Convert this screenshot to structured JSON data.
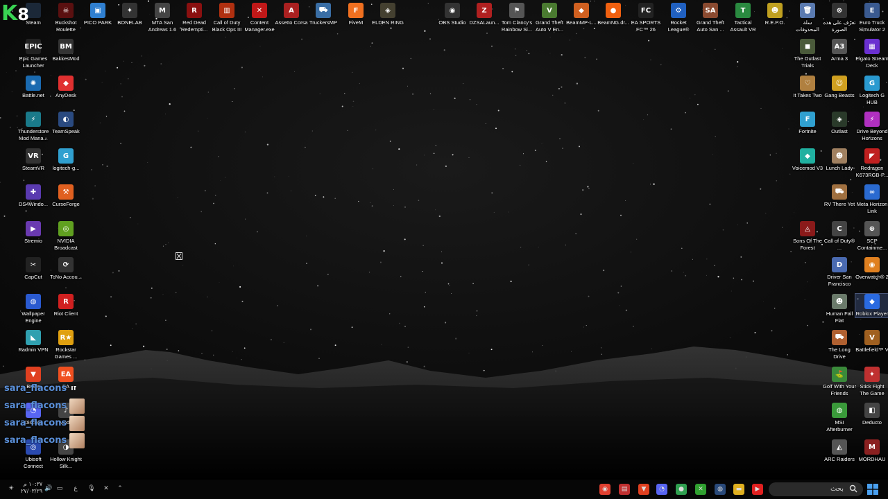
{
  "overlay": {
    "k": "K",
    "eight": "8"
  },
  "desktop_icons": [
    {
      "id": "steam",
      "label": "Steam",
      "glyph": "",
      "color": "#1b2838"
    },
    {
      "id": "buckshot",
      "label": "Buckshot Roulette",
      "glyph": "☠",
      "color": "#5a1010"
    },
    {
      "id": "pico",
      "label": "PICO PARK",
      "glyph": "▣",
      "color": "#2f7fd0"
    },
    {
      "id": "bonelab",
      "label": "BONELAB",
      "glyph": "✦",
      "color": "#333333"
    },
    {
      "id": "mta",
      "label": "MTA San Andreas 1.6",
      "glyph": "M",
      "color": "#444444"
    },
    {
      "id": "rdr",
      "label": "Red Dead Redempti...",
      "glyph": "R",
      "color": "#8a1010"
    },
    {
      "id": "cod",
      "label": "Call of Duty Black Ops III",
      "glyph": "▥",
      "color": "#b03010"
    },
    {
      "id": "cm",
      "label": "Content Manager.exe",
      "glyph": "✕",
      "color": "#c01818"
    },
    {
      "id": "assetto",
      "label": "Assetto Corsa",
      "glyph": "A",
      "color": "#aa2020"
    },
    {
      "id": "truckersmp",
      "label": "TruckersMP",
      "glyph": "⛟",
      "color": "#3a6ea5"
    },
    {
      "id": "fivem",
      "label": "FiveM",
      "glyph": "F",
      "color": "#f07020"
    },
    {
      "id": "eldenring",
      "label": "ELDEN RING",
      "glyph": "◈",
      "color": "#444030"
    },
    {
      "id": "obs",
      "label": "OBS Studio",
      "glyph": "◉",
      "color": "#333333"
    },
    {
      "id": "dzsa",
      "label": "DZSALaun...",
      "glyph": "Z",
      "color": "#b02020"
    },
    {
      "id": "r6",
      "label": "Tom Clancy's Rainbow Si...",
      "glyph": "⚑",
      "color": "#555555"
    },
    {
      "id": "gta5",
      "label": "Grand Theft Auto V En...",
      "glyph": "V",
      "color": "#4a7a30"
    },
    {
      "id": "beammp",
      "label": "BeamMP-L...",
      "glyph": "◆",
      "color": "#d06020"
    },
    {
      "id": "beamng",
      "label": "BeamNG.dr...",
      "glyph": "●",
      "color": "#f06010"
    },
    {
      "id": "fc26",
      "label": "EA SPORTS FC™ 26",
      "glyph": "FC",
      "color": "#222222"
    },
    {
      "id": "rocket",
      "label": "Rocket League®",
      "glyph": "⚙",
      "color": "#2060c0"
    },
    {
      "id": "gtasa",
      "label": "Grand Theft Auto San ...",
      "glyph": "SA",
      "color": "#8a4a30"
    },
    {
      "id": "tactical",
      "label": "Tactical Assault VR",
      "glyph": "T",
      "color": "#2a8a40"
    },
    {
      "id": "repo",
      "label": "R.E.P.O.",
      "glyph": "☻",
      "color": "#c0a020"
    },
    {
      "id": "ar1",
      "label": "سلة المحذوفات",
      "glyph": "🗑",
      "color": "#5a7ab0"
    },
    {
      "id": "ar2",
      "label": "تعرّف على هذه الصورة",
      "glyph": "⊗",
      "color": "#333333"
    },
    {
      "id": "ets2",
      "label": "Euro Truck Simulator 2",
      "glyph": "E",
      "color": "#3a5a90"
    },
    {
      "id": "epic",
      "label": "Epic Games Launcher",
      "glyph": "EPIC",
      "color": "#222222"
    },
    {
      "id": "bakkes",
      "label": "BakkesMod",
      "glyph": "BM",
      "color": "#333333"
    },
    {
      "id": "battlenet",
      "label": "Battle.net",
      "glyph": "✺",
      "color": "#1a6ab0"
    },
    {
      "id": "anydesk",
      "label": "AnyDesk",
      "glyph": "◆",
      "color": "#e03030"
    },
    {
      "id": "thunderstore",
      "label": "Thunderstore Mod Mana...",
      "glyph": "⚡",
      "color": "#1a7a8a"
    },
    {
      "id": "teamspeak",
      "label": "TeamSpeak",
      "glyph": "◐",
      "color": "#2a4a80"
    },
    {
      "id": "steamvr",
      "label": "SteamVR",
      "glyph": "VR",
      "color": "#333333"
    },
    {
      "id": "logitechg",
      "label": "logitech-g...",
      "glyph": "G",
      "color": "#30a0d0"
    },
    {
      "id": "ds4",
      "label": "DS4Windo...",
      "glyph": "✚",
      "color": "#5a3ab0"
    },
    {
      "id": "curseforge",
      "label": "CurseForge",
      "glyph": "⚒",
      "color": "#e06020"
    },
    {
      "id": "stremio",
      "label": "Stremio",
      "glyph": "▶",
      "color": "#6a3ab0"
    },
    {
      "id": "nvidia",
      "label": "NVIDIA Broadcast",
      "glyph": "◎",
      "color": "#60a020"
    },
    {
      "id": "capcut",
      "label": "CapCut",
      "glyph": "✂",
      "color": "#222222"
    },
    {
      "id": "tcno",
      "label": "TcNo Accou...",
      "glyph": "⟳",
      "color": "#333333"
    },
    {
      "id": "wallpaper",
      "label": "Wallpaper Engine",
      "glyph": "◍",
      "color": "#2a5ad0"
    },
    {
      "id": "riot",
      "label": "Riot Client",
      "glyph": "R",
      "color": "#d02020"
    },
    {
      "id": "radmin",
      "label": "Radmin VPN",
      "glyph": "◣",
      "color": "#30a0b0"
    },
    {
      "id": "rockstar",
      "label": "Rockstar Games ...",
      "glyph": "R★",
      "color": "#e0a010"
    },
    {
      "id": "brave",
      "label": "Brave",
      "glyph": "▼",
      "color": "#e04020"
    },
    {
      "id": "ea",
      "label": "EA",
      "glyph": "EA",
      "color": "#f05020"
    },
    {
      "id": "discord",
      "label": "Discord",
      "glyph": "◔",
      "color": "#5865f2"
    },
    {
      "id": "mode",
      "label": "Mode",
      "glyph": "♪",
      "color": "#444444"
    },
    {
      "id": "ubisoft",
      "label": "Ubisoft Connect",
      "glyph": "◎",
      "color": "#2a4ab0"
    },
    {
      "id": "hollow",
      "label": "Hollow Knight Silk...",
      "glyph": "◑",
      "color": "#444444"
    },
    {
      "id": "outlast_trials",
      "label": "The Outlast Trials",
      "glyph": "◼",
      "color": "#4a5a3a"
    },
    {
      "id": "arma3",
      "label": "Arma 3",
      "glyph": "A3",
      "color": "#555555"
    },
    {
      "id": "elgato",
      "label": "Elgato Stream Deck",
      "glyph": "▦",
      "color": "#6a30d0"
    },
    {
      "id": "ittakestwo",
      "label": "It Takes Two",
      "glyph": "♡",
      "color": "#b08040"
    },
    {
      "id": "gangbeasts",
      "label": "Gang Beasts",
      "glyph": "☺",
      "color": "#d0a020"
    },
    {
      "id": "ghub",
      "label": "Logitech G HUB",
      "glyph": "G",
      "color": "#2a9ad0"
    },
    {
      "id": "fortnite",
      "label": "Fortnite",
      "glyph": "F",
      "color": "#30a0d0"
    },
    {
      "id": "outlast",
      "label": "Outlast",
      "glyph": "◈",
      "color": "#2a3a2a"
    },
    {
      "id": "drivebeyond",
      "label": "Drive Beyond Horizons",
      "glyph": "⚡",
      "color": "#b030c0"
    },
    {
      "id": "voicemod",
      "label": "Voicemod V3",
      "glyph": "◆",
      "color": "#20b0a0"
    },
    {
      "id": "lunchlady",
      "label": "Lunch Lady",
      "glyph": "☻",
      "color": "#a08060"
    },
    {
      "id": "redragon",
      "label": "Redragon K673RGB-P...",
      "glyph": "◤",
      "color": "#c02020"
    },
    {
      "id": "rvthere",
      "label": "RV There Yet",
      "glyph": "⛟",
      "color": "#a07040"
    },
    {
      "id": "metahorizon",
      "label": "Meta Horizon Link",
      "glyph": "∞",
      "color": "#2a6ad0"
    },
    {
      "id": "sonsforest",
      "label": "Sons Of The Forest",
      "glyph": "◬",
      "color": "#8a1a1a"
    },
    {
      "id": "codmw",
      "label": "Call of Duty® ...",
      "glyph": "C",
      "color": "#444444"
    },
    {
      "id": "scp",
      "label": "SCP Containme...",
      "glyph": "⊕",
      "color": "#555555"
    },
    {
      "id": "driversf",
      "label": "Driver San Francisco",
      "glyph": "D",
      "color": "#4a6ab0"
    },
    {
      "id": "overwatch",
      "label": "Overwatch® 2",
      "glyph": "◉",
      "color": "#e08020"
    },
    {
      "id": "humanfall",
      "label": "Human Fall Flat",
      "glyph": "☻",
      "color": "#6a7a6a"
    },
    {
      "id": "roblox",
      "label": "Roblox Player",
      "glyph": "◆",
      "color": "#2a6ae0"
    },
    {
      "id": "longdrive",
      "label": "The Long Drive",
      "glyph": "⛟",
      "color": "#b06030"
    },
    {
      "id": "bf5",
      "label": "Battlefield™ V",
      "glyph": "V",
      "color": "#a06020"
    },
    {
      "id": "golf",
      "label": "Golf With Your Friends",
      "glyph": "⛳",
      "color": "#3a8a3a"
    },
    {
      "id": "stickfight",
      "label": "Stick Fight The Game",
      "glyph": "✦",
      "color": "#c03030"
    },
    {
      "id": "msi",
      "label": "MSI Afterburner",
      "glyph": "◍",
      "color": "#3a9a3a"
    },
    {
      "id": "deducto",
      "label": "Deducto",
      "glyph": "◧",
      "color": "#444444"
    },
    {
      "id": "arcraiders",
      "label": "ARC Raiders",
      "glyph": "◭",
      "color": "#555555"
    },
    {
      "id": "mordhau",
      "label": "MORDHAU",
      "glyph": "M",
      "color": "#8a2020"
    }
  ],
  "chat": {
    "username": "sara_flacons",
    "suffix": "זו"
  },
  "taskbar": {
    "search_placeholder": "بحث",
    "clock_time": "١٠:٣٧ م",
    "clock_date": "٢٧/٠٣/٢٩",
    "language": "ع",
    "apps": [
      {
        "id": "overwatch",
        "glyph": "◉",
        "color": "#e04030"
      },
      {
        "id": "mystery",
        "glyph": "▤",
        "color": "#c03030"
      },
      {
        "id": "brave",
        "glyph": "▼",
        "color": "#e04020"
      },
      {
        "id": "discord",
        "glyph": "◔",
        "color": "#5865f2"
      },
      {
        "id": "chrome",
        "glyph": "●",
        "color": "#30a050"
      },
      {
        "id": "xbox",
        "glyph": "✕",
        "color": "#30a030"
      },
      {
        "id": "steam",
        "glyph": "◍",
        "color": "#2a4a7a"
      },
      {
        "id": "explorer",
        "glyph": "▬",
        "color": "#e0b020"
      },
      {
        "id": "youtube",
        "glyph": "▶",
        "color": "#e02020"
      }
    ],
    "colors": {
      "bg": "#060606",
      "search_bg": "#2a2a2a"
    }
  }
}
